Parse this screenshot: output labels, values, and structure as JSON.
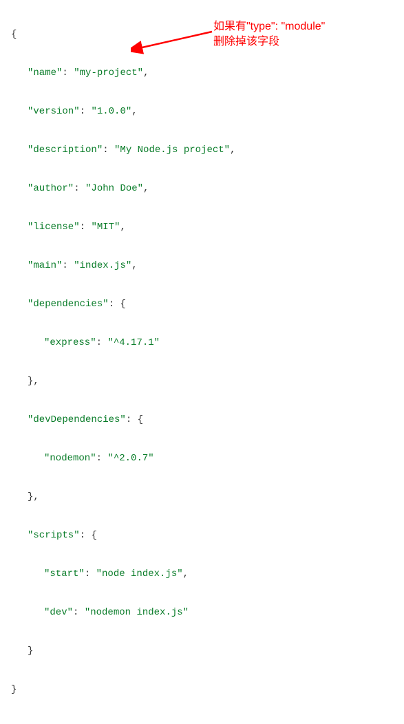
{
  "annotation": {
    "line1": "如果有\"type\": \"module\"",
    "line2": "删除掉该字段"
  },
  "code": {
    "open": "{",
    "nameKey": "\"name\"",
    "nameVal": "\"my-project\"",
    "versionKey": "\"version\"",
    "versionVal": "\"1.0.0\"",
    "descKey": "\"description\"",
    "descVal": "\"My Node.js project\"",
    "authorKey": "\"author\"",
    "authorVal": "\"John Doe\"",
    "licenseKey": "\"license\"",
    "licenseVal": "\"MIT\"",
    "mainKey": "\"main\"",
    "mainVal": "\"index.js\"",
    "depsKey": "\"dependencies\"",
    "expressKey": "\"express\"",
    "expressVal": "\"^4.17.1\"",
    "devDepsKey": "\"devDependencies\"",
    "nodemonKey": "\"nodemon\"",
    "nodemonVal": "\"^2.0.7\"",
    "scriptsKey": "\"scripts\"",
    "startKey": "\"start\"",
    "startVal": "\"node index.js\"",
    "devKey": "\"dev\"",
    "devVal": "\"nodemon index.js\"",
    "closeBrace": "}",
    "closeBraceComma": "},",
    "colon": ": ",
    "comma": ",",
    "openBrace": "{",
    "close": "}"
  }
}
